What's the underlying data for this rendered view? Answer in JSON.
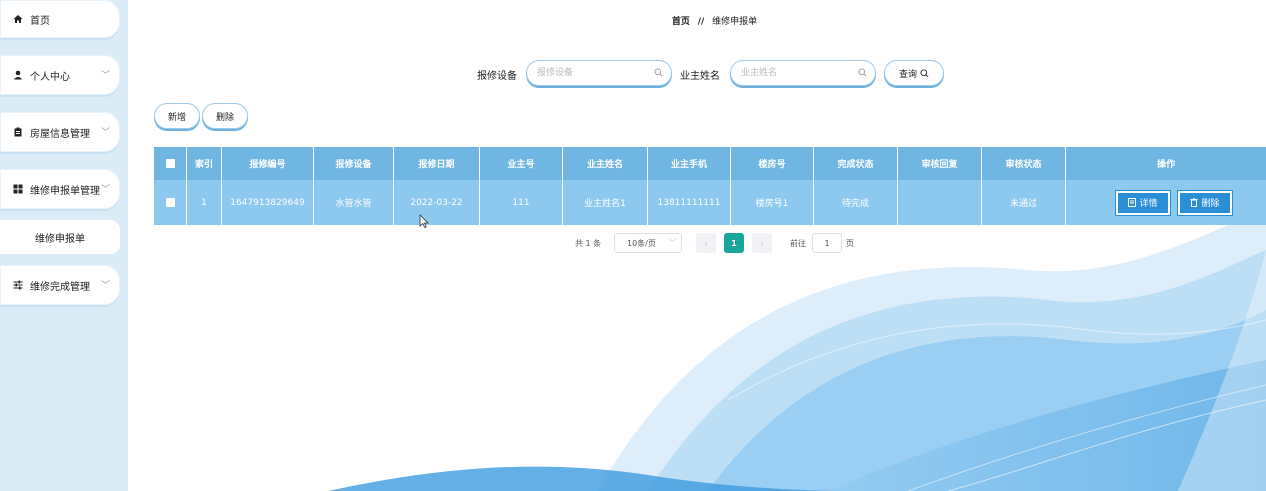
{
  "sidebar": {
    "items": [
      {
        "label": "首页",
        "icon": "home-icon",
        "expandable": false
      },
      {
        "label": "个人中心",
        "icon": "user-icon",
        "expandable": true
      },
      {
        "label": "房屋信息管理",
        "icon": "clipboard-icon",
        "expandable": true
      },
      {
        "label": "维修申报单管理",
        "icon": "grid-icon",
        "expandable": true
      },
      {
        "label": "维修完成管理",
        "icon": "sliders-icon",
        "expandable": true
      }
    ],
    "subitem": "维修申报单"
  },
  "breadcrumb": {
    "home": "首页",
    "sep": "//",
    "current": "维修申报单"
  },
  "search": {
    "device_label": "报修设备",
    "device_placeholder": "报修设备",
    "owner_label": "业主姓名",
    "owner_placeholder": "业主姓名",
    "query_button": "查询"
  },
  "toolbar": {
    "add": "新增",
    "delete": "删除"
  },
  "table": {
    "headers": [
      "索引",
      "报修编号",
      "报修设备",
      "报修日期",
      "业主号",
      "业主姓名",
      "业主手机",
      "楼房号",
      "完成状态",
      "审核回复",
      "审核状态",
      "操作"
    ],
    "rows": [
      {
        "index": "1",
        "repair_no": "1647913829649",
        "device": "水管水管",
        "date": "2022-03-22",
        "owner_no": "111",
        "owner_name": "业主姓名1",
        "phone": "13811111111",
        "building": "楼房号1",
        "finish_status": "待完成",
        "review_reply": "",
        "review_status": "未通过",
        "detail_btn": "详情",
        "delete_btn": "删除"
      }
    ]
  },
  "pagination": {
    "total": "共 1 条",
    "page_size": "10条/页",
    "current": "1",
    "goto_label": "前往",
    "goto_value": "1",
    "page_unit": "页"
  },
  "colors": {
    "header": "#6fb6e3",
    "row": "#8dc8ee",
    "accent": "#2b8fd6",
    "active_page": "#1aa59a",
    "sidebar": "#dcecf7"
  }
}
